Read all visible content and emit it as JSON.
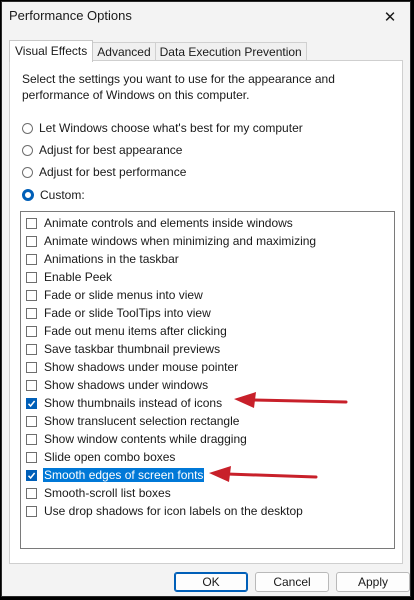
{
  "window": {
    "title": "Performance Options",
    "close_glyph": "✕"
  },
  "tabs": [
    {
      "label": "Visual Effects"
    },
    {
      "label": "Advanced"
    },
    {
      "label": "Data Execution Prevention"
    }
  ],
  "description": "Select the settings you want to use for the appearance and performance of Windows on this computer.",
  "radios": [
    {
      "label": "Let Windows choose what's best for my computer",
      "checked": false
    },
    {
      "label": "Adjust for best appearance",
      "checked": false
    },
    {
      "label": "Adjust for best performance",
      "checked": false
    },
    {
      "label": "Custom:",
      "checked": true
    }
  ],
  "effects": [
    {
      "label": "Animate controls and elements inside windows",
      "checked": false
    },
    {
      "label": "Animate windows when minimizing and maximizing",
      "checked": false
    },
    {
      "label": "Animations in the taskbar",
      "checked": false
    },
    {
      "label": "Enable Peek",
      "checked": false
    },
    {
      "label": "Fade or slide menus into view",
      "checked": false
    },
    {
      "label": "Fade or slide ToolTips into view",
      "checked": false
    },
    {
      "label": "Fade out menu items after clicking",
      "checked": false
    },
    {
      "label": "Save taskbar thumbnail previews",
      "checked": false
    },
    {
      "label": "Show shadows under mouse pointer",
      "checked": false
    },
    {
      "label": "Show shadows under windows",
      "checked": false
    },
    {
      "label": "Show thumbnails instead of icons",
      "checked": true
    },
    {
      "label": "Show translucent selection rectangle",
      "checked": false
    },
    {
      "label": "Show window contents while dragging",
      "checked": false
    },
    {
      "label": "Slide open combo boxes",
      "checked": false
    },
    {
      "label": "Smooth edges of screen fonts",
      "checked": true,
      "selected": true
    },
    {
      "label": "Smooth-scroll list boxes",
      "checked": false
    },
    {
      "label": "Use drop shadows for icon labels on the desktop",
      "checked": false
    }
  ],
  "buttons": {
    "ok": "OK",
    "cancel": "Cancel",
    "apply": "Apply"
  },
  "colors": {
    "accent": "#005fb8",
    "selection": "#0078d7",
    "annotation_arrow": "#c8202a"
  }
}
